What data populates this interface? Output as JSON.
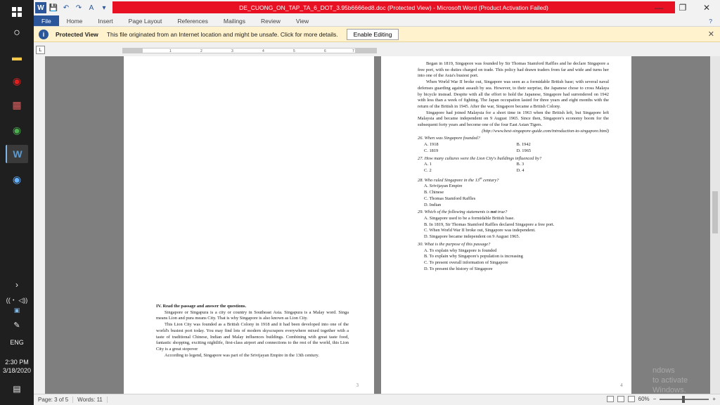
{
  "window": {
    "title": "DE_CUONG_ON_TAP_TA_6_DOT_3.95b6666ed8.doc (Protected View) - Microsoft Word (Product Activation Failed)",
    "min_icon": "—",
    "restore_icon": "❐",
    "close_icon": "✕",
    "help_icon": "?"
  },
  "quick_access": {
    "word_icon": "W",
    "save_icon": "💾",
    "undo_icon": "↶",
    "redo_icon": "↷",
    "font_icon": "A",
    "more_icon": "▾"
  },
  "ribbon": {
    "tabs": [
      "File",
      "Home",
      "Insert",
      "Page Layout",
      "References",
      "Mailings",
      "Review",
      "View"
    ]
  },
  "protected_view": {
    "icon": "i",
    "title": "Protected View",
    "message": "This file originated from an Internet location and might be unsafe. Click for more details.",
    "button": "Enable Editing",
    "close": "✕"
  },
  "ruler": {
    "tab_selector": "L",
    "marks": [
      "1",
      "2",
      "3",
      "4",
      "5",
      "6",
      "7"
    ]
  },
  "page3": {
    "heading": "IV. Read the passage and answer the questions.",
    "paragraphs": [
      "Singapore or Singapura is a city or country in Southeast Asia. Singapura is a Malay word. Singa means Lion and pura means City. That is why Singapore is also known as Lion City.",
      "This Lion City was founded as a British Colony in 1918 and it had been developed into one of the world's busiest port today. You may find lots of modern skyscrapers everywhere mixed together with a taste of traditional Chinese, Indian and Malay influences buildings. Combining with great taste food, fantastic shopping, exciting nightlife, first-class airport and connections to the rest of the world, this Lion City is a great stopover",
      "According to legend, Singapore was part of the Srivijayan Empire in the 13th century."
    ],
    "number": "3"
  },
  "page4": {
    "paragraphs": [
      "Began in 1819, Singapore was founded by Sir Thomas Stamford Raffles and he declare Singapore a free port, with no duties charged on trade. This policy had drawn traders from far and wide and turns her into one of the Asia's busiest port.",
      "When World War II broke out, Singapore was seen as a formidable British base; with several naval defenses guarding against assault by sea. However, to their surprise, the Japanese chose to cross Malaya by bicycle instead. Despite with all the effort to hold the Japanese, Singapore had surrendered on 1942 with less than a week of fighting. The Japan occupation lasted for three years and eight months with the return of the British in 1945. After the war, Singapore became a British Colony.",
      "Singapore had joined Malaysia for a short time in 1963 when the British left, but Singapore left Malaysia and became independent on 9 August 1965. Since then, Singapore's economy boom for the subsequent forty years and become one of the four East Asian Tigers."
    ],
    "source": "(http://www.best-singapore-guide.com/introduction-to-singapore.html)",
    "q26": "26. When was Singapore founded?",
    "q26_opts": [
      "A. 1918",
      "B. 1942",
      "C. 1819",
      "D. 1965"
    ],
    "q27": "27. How many cultures were the Lion City's buildings influenced by?",
    "q27_opts": [
      "A. 1",
      "B. 3",
      "C. 2",
      "D. 4"
    ],
    "q28_pre": "28. Who ruled Singapore in the 13",
    "q28_sup": "th",
    "q28_post": " century?",
    "q28_opts": [
      "A. Srivijayan Empire",
      "B. Chinese",
      "C. Thomas Stamford Raffles",
      "D. Indian"
    ],
    "q29_pre": "29. Which of the following statements is ",
    "q29_not": "not",
    "q29_post": " true?",
    "q29_opts": [
      "A. Singapore used to be a formidable British base.",
      "B. In 1819, Sir Thomas Stamford Raffles declared Singapore a free port.",
      "C. When World War II broke out, Singapore was independent.",
      "D. Singapore became independent on 9 August 1965."
    ],
    "q30": "30. What is the purpose of this passage?",
    "q30_opts": [
      "A. To explain why Singapore is founded",
      "B. To explain why Singapore's population is increasing",
      "C. To present overall information of Singapore",
      "D. To present the history of Singapore"
    ],
    "number": "4"
  },
  "watermark": {
    "line1": "ndows",
    "line2": "to activate Windows."
  },
  "status": {
    "page": "Page: 3 of 5",
    "words": "Words: 11",
    "zoom": "60%",
    "zoom_out": "−",
    "zoom_in": "+"
  },
  "taskbar": {
    "icons": [
      "○",
      "▬",
      "◉",
      "▦",
      "◉",
      "W",
      "◉"
    ],
    "expand": "›",
    "net": "((・ ◁))",
    "lang_icon": "▣",
    "pen_icon": "✎",
    "lang": "ENG",
    "time": "2:30 PM",
    "date": "3/18/2020",
    "notif": "▤"
  },
  "colors": {
    "title_red": "#e81123",
    "file_tab": "#2b579a",
    "banner": "#fff2cc"
  }
}
